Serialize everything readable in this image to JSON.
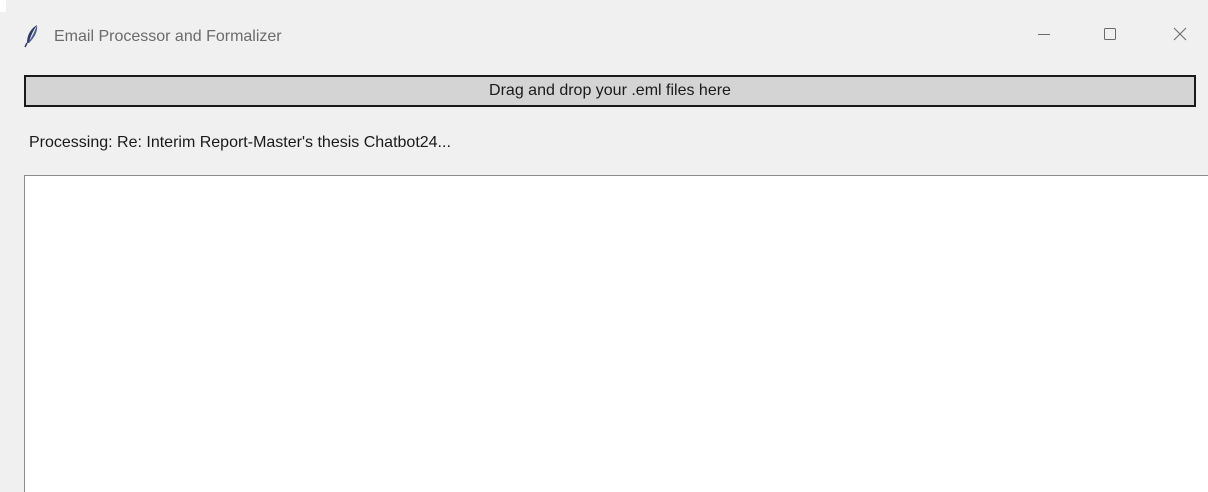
{
  "window": {
    "title": "Email Processor and Formalizer",
    "controls": {
      "minimize": "minimize-icon",
      "maximize": "maximize-icon",
      "close": "close-icon"
    }
  },
  "drop_zone": {
    "label": "Drag and drop your .eml files here"
  },
  "status": {
    "text": "Processing: Re: Interim Report-Master's thesis Chatbot24..."
  },
  "output": {
    "content": ""
  },
  "icons": {
    "app": "feather-icon"
  },
  "colors": {
    "window_bg": "#f0f0f0",
    "drop_zone_bg": "#d4d4d4",
    "drop_zone_border": "#1a1a1a",
    "text_area_bg": "#ffffff",
    "title_text": "#6b6b6b"
  }
}
